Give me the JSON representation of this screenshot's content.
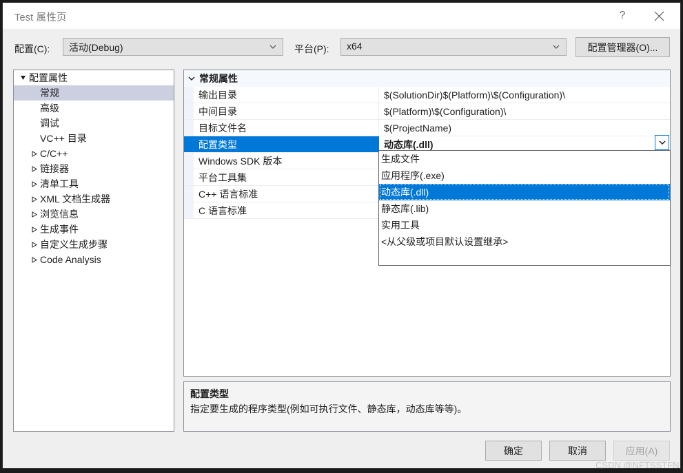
{
  "window": {
    "title": "Test 属性页",
    "help_icon": "question-mark-icon",
    "close_icon": "close-icon"
  },
  "config_bar": {
    "configuration_label": "配置(C):",
    "configuration_value": "活动(Debug)",
    "platform_label": "平台(P):",
    "platform_value": "x64",
    "config_manager_button": "配置管理器(O)...",
    "chevron_icon": "chevron-down-icon"
  },
  "tree": {
    "items": [
      {
        "label": "配置属性",
        "level": 0,
        "twisty": "expanded",
        "selected": false
      },
      {
        "label": "常规",
        "level": 1,
        "twisty": "none",
        "selected": true
      },
      {
        "label": "高级",
        "level": 1,
        "twisty": "none",
        "selected": false
      },
      {
        "label": "调试",
        "level": 1,
        "twisty": "none",
        "selected": false
      },
      {
        "label": "VC++ 目录",
        "level": 1,
        "twisty": "none",
        "selected": false
      },
      {
        "label": "C/C++",
        "level": 1,
        "twisty": "collapsed",
        "selected": false
      },
      {
        "label": "链接器",
        "level": 1,
        "twisty": "collapsed",
        "selected": false
      },
      {
        "label": "清单工具",
        "level": 1,
        "twisty": "collapsed",
        "selected": false
      },
      {
        "label": "XML 文档生成器",
        "level": 1,
        "twisty": "collapsed",
        "selected": false
      },
      {
        "label": "浏览信息",
        "level": 1,
        "twisty": "collapsed",
        "selected": false
      },
      {
        "label": "生成事件",
        "level": 1,
        "twisty": "collapsed",
        "selected": false
      },
      {
        "label": "自定义生成步骤",
        "level": 1,
        "twisty": "collapsed",
        "selected": false
      },
      {
        "label": "Code Analysis",
        "level": 1,
        "twisty": "collapsed",
        "selected": false
      }
    ]
  },
  "grid": {
    "section_header": "常规属性",
    "section_chevron_icon": "chevron-down-icon",
    "rows": [
      {
        "name": "输出目录",
        "value": "$(SolutionDir)$(Platform)\\$(Configuration)\\",
        "selected": false
      },
      {
        "name": "中间目录",
        "value": "$(Platform)\\$(Configuration)\\",
        "selected": false
      },
      {
        "name": "目标文件名",
        "value": "$(ProjectName)",
        "selected": false
      },
      {
        "name": "配置类型",
        "value": "动态库(.dll)",
        "selected": true
      },
      {
        "name": "Windows SDK 版本",
        "value": "",
        "selected": false
      },
      {
        "name": "平台工具集",
        "value": "",
        "selected": false
      },
      {
        "name": "C++ 语言标准",
        "value": "",
        "selected": false
      },
      {
        "name": "C 语言标准",
        "value": "",
        "selected": false
      }
    ]
  },
  "dropdown": {
    "open": true,
    "editor_chevron_icon": "chevron-down-icon",
    "options": [
      {
        "label": "生成文件",
        "selected": false
      },
      {
        "label": "应用程序(.exe)",
        "selected": false
      },
      {
        "label": "动态库(.dll)",
        "selected": true
      },
      {
        "label": "静态库(.lib)",
        "selected": false
      },
      {
        "label": "实用工具",
        "selected": false
      },
      {
        "label": "<从父级或项目默认设置继承>",
        "selected": false
      }
    ]
  },
  "description": {
    "title": "配置类型",
    "body": "指定要生成的程序类型(例如可执行文件、静态库，动态库等等)。"
  },
  "footer": {
    "ok_label": "确定",
    "cancel_label": "取消",
    "apply_label": "应用(A)",
    "apply_disabled": true
  },
  "watermark": {
    "text": "CSDN @NFTSSTFN"
  },
  "colors": {
    "accent": "#0078d7",
    "tree_selection": "#cbcfe0",
    "dialog_bg": "#efefef",
    "titlebar_bg": "#ffffff",
    "panel_bg": "#ffffff",
    "desc_bg": "#f4f4f4",
    "grid_header_bg": "#f5f8fc"
  }
}
